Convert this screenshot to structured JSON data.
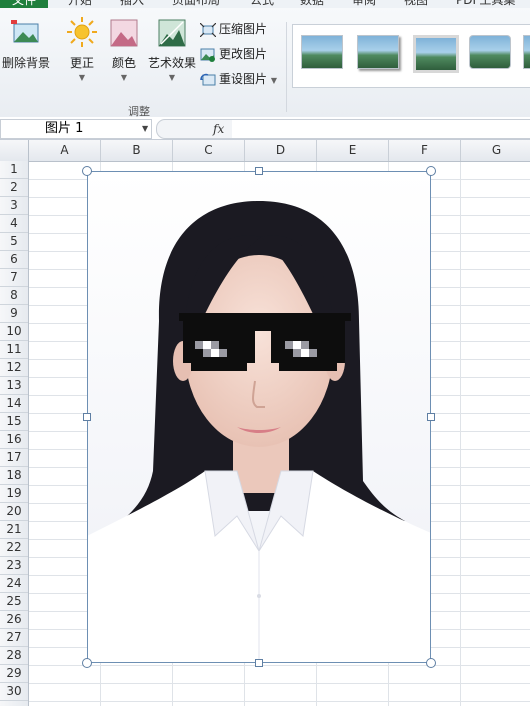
{
  "ribbon": {
    "tabs": [
      {
        "label": "文件",
        "active": true
      },
      {
        "label": "开始"
      },
      {
        "label": "插入"
      },
      {
        "label": "页面布局"
      },
      {
        "label": "公式"
      },
      {
        "label": "数据"
      },
      {
        "label": "审阅"
      },
      {
        "label": "视图"
      },
      {
        "label": "PDF工具集"
      }
    ],
    "buttons": {
      "remove_bg": "删除背景",
      "corrections": "更正",
      "color": "颜色",
      "artistic": "艺术效果",
      "compress": "压缩图片",
      "change": "更改图片",
      "reset": "重设图片"
    },
    "group_label": "调整"
  },
  "formula_bar": {
    "name_box": "图片 1",
    "fx_label": "fx",
    "formula": ""
  },
  "sheet": {
    "columns": [
      "A",
      "B",
      "C",
      "D",
      "E",
      "F",
      "G"
    ],
    "rows": [
      "1",
      "2",
      "3",
      "4",
      "5",
      "6",
      "7",
      "8",
      "9",
      "10",
      "11",
      "12",
      "13",
      "14",
      "15",
      "16",
      "17",
      "18",
      "19",
      "20",
      "21",
      "22",
      "23",
      "24",
      "25",
      "26",
      "27",
      "28",
      "29",
      "30"
    ]
  },
  "picture": {
    "subject": "portrait-with-pixel-sunglasses",
    "colors": {
      "hair": "#1b1a22",
      "skin": "#f1d3c8",
      "shirt": "#ffffff",
      "glasses": "#0d0d0d"
    }
  },
  "colors": {
    "file_tab": "#1f7f3c",
    "ribbon_bg": "#eef2f6",
    "selection": "#6d8fb3"
  }
}
